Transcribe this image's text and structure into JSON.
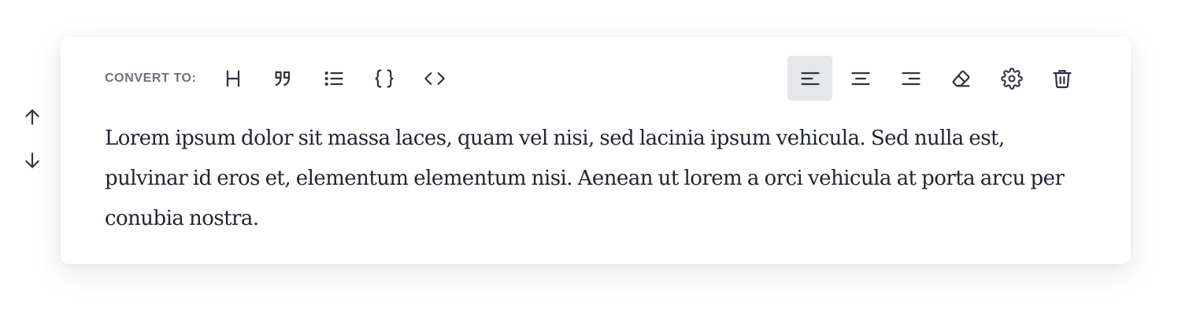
{
  "toolbar": {
    "convert_label": "CONVERT TO:",
    "convert_options": [
      {
        "name": "heading",
        "icon": "heading-icon"
      },
      {
        "name": "quote",
        "icon": "quote-icon"
      },
      {
        "name": "list",
        "icon": "list-icon"
      },
      {
        "name": "json",
        "icon": "braces-icon"
      },
      {
        "name": "code",
        "icon": "code-icon"
      }
    ],
    "actions": [
      {
        "name": "align-left",
        "icon": "align-left-icon",
        "active": true
      },
      {
        "name": "align-center",
        "icon": "align-center-icon",
        "active": false
      },
      {
        "name": "align-right",
        "icon": "align-right-icon",
        "active": false
      },
      {
        "name": "clear-formatting",
        "icon": "eraser-icon",
        "active": false
      },
      {
        "name": "settings",
        "icon": "gear-icon",
        "active": false
      },
      {
        "name": "delete",
        "icon": "trash-icon",
        "active": false
      }
    ]
  },
  "block": {
    "text": "Lorem ipsum dolor sit massa laces, quam vel nisi, sed lacinia ipsum vehicula. Sed nulla est, pulvinar id eros et, elementum elementum nisi. Aenean ut lorem a orci vehicula at porta arcu per conubia nostra."
  },
  "move": {
    "up_icon": "arrow-up-icon",
    "down_icon": "arrow-down-icon"
  },
  "colors": {
    "icon": "#2f3441",
    "label": "#6b7280",
    "active_bg": "#e6e7ea",
    "text": "#1f2430"
  }
}
